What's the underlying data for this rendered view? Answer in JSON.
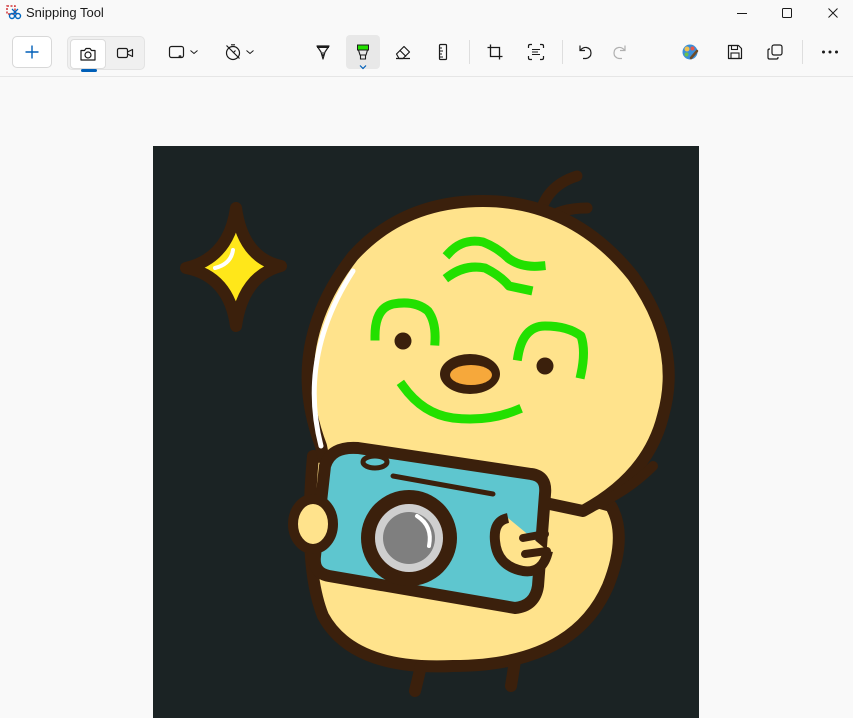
{
  "window": {
    "title": "Snipping Tool",
    "controls": [
      "minimize",
      "maximize",
      "close"
    ]
  },
  "toolbar": {
    "new_label": "+",
    "capture_modes": [
      {
        "icon": "camera-icon",
        "selected": true
      },
      {
        "icon": "video-icon",
        "selected": false
      }
    ],
    "snip_shape": {
      "icon": "rectangle-snip-icon"
    },
    "delay": {
      "icon": "timer-off-icon"
    },
    "markup_tools": [
      {
        "icon": "ballpoint-pen-icon",
        "active": false
      },
      {
        "icon": "highlighter-icon",
        "active": true,
        "color": "#22e000"
      },
      {
        "icon": "eraser-icon",
        "active": false
      },
      {
        "icon": "ruler-icon",
        "active": false
      }
    ],
    "edit_tools": [
      "crop-icon",
      "text-actions-icon"
    ],
    "history": [
      "undo-icon",
      "redo-icon"
    ],
    "actions": [
      "edit-in-paint-icon",
      "save-icon",
      "copy-icon",
      "more-icon"
    ]
  },
  "canvas": {
    "background": "#1b2324",
    "subject": "chick-with-camera",
    "highlight_color": "#22e000"
  }
}
